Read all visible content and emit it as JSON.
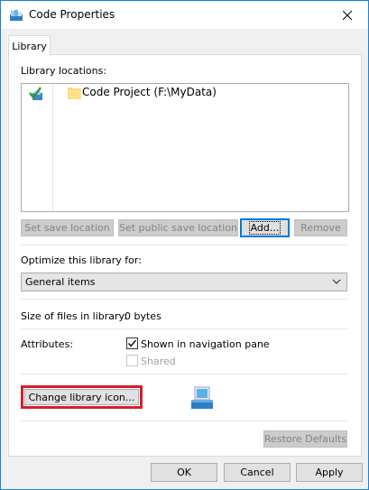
{
  "window": {
    "title": "Code Properties",
    "title_icon": "library-icon",
    "close_icon": "close-icon"
  },
  "tabs": [
    {
      "label": "Library",
      "active": true
    }
  ],
  "library": {
    "locations_label": "Library locations:",
    "locations": [
      {
        "name": "Code Project (F:\\MyData)",
        "icon": "folder-icon",
        "status_icon": "default-save-location-icon"
      }
    ],
    "buttons": {
      "set_save": "Set save location",
      "set_public": "Set public save location",
      "add": "Add...",
      "remove": "Remove"
    },
    "optimize_label": "Optimize this library for:",
    "optimize_value": "General items",
    "size_label": "Size of files in library:",
    "size_value": "0 bytes",
    "attributes_label": "Attributes:",
    "attr_shown": {
      "label": "Shown in navigation pane",
      "checked": true
    },
    "attr_shared": {
      "label": "Shared",
      "checked": false,
      "disabled": true
    },
    "change_icon": "Change library icon...",
    "restore": "Restore Defaults"
  },
  "footer": {
    "ok": "OK",
    "cancel": "Cancel",
    "apply": "Apply"
  },
  "colors": {
    "accent": "#0078d7",
    "highlight": "#d81e2c"
  }
}
